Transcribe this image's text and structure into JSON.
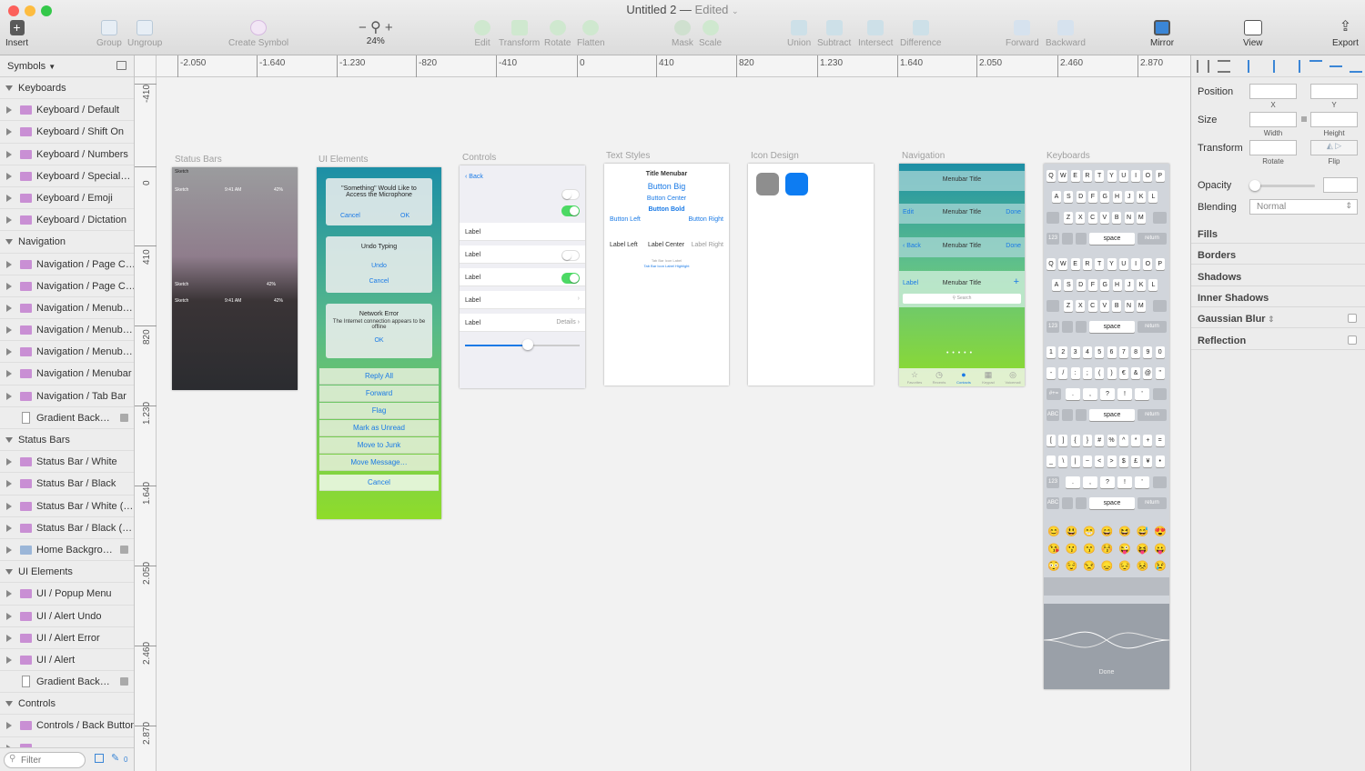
{
  "window": {
    "title": "Untitled 2",
    "status": "Edited"
  },
  "toolbar": {
    "insert": "Insert",
    "group": "Group",
    "ungroup": "Ungroup",
    "create_symbol": "Create Symbol",
    "zoom": "24%",
    "zoom_minus": "−",
    "zoom_plus": "+",
    "edit": "Edit",
    "transform": "Transform",
    "rotate": "Rotate",
    "flatten": "Flatten",
    "mask": "Mask",
    "scale": "Scale",
    "union": "Union",
    "subtract": "Subtract",
    "intersect": "Intersect",
    "difference": "Difference",
    "forward": "Forward",
    "backward": "Backward",
    "mirror": "Mirror",
    "view": "View",
    "export": "Export"
  },
  "ruler_h": [
    "-2.050",
    "-1.640",
    "-1.230",
    "-820",
    "-410",
    "0",
    "410",
    "820",
    "1.230",
    "1.640",
    "2.050",
    "2.460",
    "2.870"
  ],
  "ruler_v": [
    "-410",
    "0",
    "410",
    "820",
    "1.230",
    "1.640",
    "2.050",
    "2.460",
    "2.870"
  ],
  "sidebar": {
    "page_select": "Symbols",
    "rows": [
      {
        "type": "group",
        "label": "Keyboards"
      },
      {
        "type": "item",
        "label": "Keyboard / Default"
      },
      {
        "type": "item",
        "label": "Keyboard / Shift On"
      },
      {
        "type": "item",
        "label": "Keyboard / Numbers"
      },
      {
        "type": "item",
        "label": "Keyboard / Special…"
      },
      {
        "type": "item",
        "label": "Keyboard / Emoji"
      },
      {
        "type": "item",
        "label": "Keyboard / Dictation"
      },
      {
        "type": "group",
        "label": "Navigation"
      },
      {
        "type": "item",
        "label": "Navigation / Page C…"
      },
      {
        "type": "item",
        "label": "Navigation / Page C…"
      },
      {
        "type": "item",
        "label": "Navigation / Menub…"
      },
      {
        "type": "item",
        "label": "Navigation / Menub…"
      },
      {
        "type": "item",
        "label": "Navigation / Menub…"
      },
      {
        "type": "item",
        "label": "Navigation / Menubar"
      },
      {
        "type": "item",
        "label": "Navigation / Tab Bar"
      },
      {
        "type": "doc",
        "label": "Gradient Back…"
      },
      {
        "type": "group",
        "label": "Status Bars"
      },
      {
        "type": "item",
        "label": "Status Bar / White"
      },
      {
        "type": "item",
        "label": "Status Bar / Black"
      },
      {
        "type": "item",
        "label": "Status Bar / White (…"
      },
      {
        "type": "item",
        "label": "Status Bar / Black (…"
      },
      {
        "type": "itemblue",
        "label": "Home Backgro…"
      },
      {
        "type": "group",
        "label": "UI Elements"
      },
      {
        "type": "item",
        "label": "UI / Popup Menu"
      },
      {
        "type": "item",
        "label": "UI / Alert Undo"
      },
      {
        "type": "item",
        "label": "UI / Alert Error"
      },
      {
        "type": "item",
        "label": "UI / Alert"
      },
      {
        "type": "doc",
        "label": "Gradient Back…"
      },
      {
        "type": "group",
        "label": "Controls"
      },
      {
        "type": "item",
        "label": "Controls / Back Button"
      },
      {
        "type": "item",
        "label": ""
      }
    ],
    "filter_placeholder": "Filter",
    "filter_count": "0"
  },
  "artboards": {
    "status_bars": {
      "label": "Status Bars",
      "carrier": "Sketch",
      "time": "9:41 AM",
      "battery": "42%"
    },
    "ui_elements": {
      "label": "UI Elements",
      "alert_title": "\"Something\" Would Like to Access the Microphone",
      "alert_cancel": "Cancel",
      "alert_ok": "OK",
      "undo_title": "Undo Typing",
      "undo_btn": "Undo",
      "undo_cancel": "Cancel",
      "err_title": "Network Error",
      "err_msg": "The Internet connection appears to be offline",
      "err_ok": "OK",
      "actions": [
        "Reply All",
        "Forward",
        "Flag",
        "Mark as Unread",
        "Move to Junk",
        "Move Message…"
      ],
      "cancel": "Cancel"
    },
    "controls": {
      "label": "Controls",
      "back": "Back",
      "row_label": "Label",
      "details": "Details"
    },
    "text_styles": {
      "label": "Text Styles",
      "title_menubar": "Title Menubar",
      "button_big": "Button Big",
      "button_center": "Button Center",
      "button_bold": "Button Bold",
      "button_left": "Button Left",
      "button_right": "Button Right",
      "label_left": "Label Left",
      "label_center": "Label Center",
      "label_right": "Label Right",
      "tab_icon_label": "Tab Bar Icon Label",
      "tab_icon_label_hl": "Tab Bar Icon Label Highlight"
    },
    "icon_design": {
      "label": "Icon Design"
    },
    "navigation": {
      "label": "Navigation",
      "menubar_title": "Menubar Title",
      "edit": "Edit",
      "done": "Done",
      "back": "Back",
      "label_link": "Label",
      "search": "Search",
      "tabs": [
        "Favorites",
        "Recents",
        "Contacts",
        "Keypad",
        "Voicemail"
      ]
    },
    "keyboards": {
      "label": "Keyboards",
      "row1": [
        "Q",
        "W",
        "E",
        "R",
        "T",
        "Y",
        "U",
        "I",
        "O",
        "P"
      ],
      "row2": [
        "A",
        "S",
        "D",
        "F",
        "G",
        "H",
        "J",
        "K",
        "L"
      ],
      "row3": [
        "Z",
        "X",
        "C",
        "V",
        "B",
        "N",
        "M"
      ],
      "num1": [
        "1",
        "2",
        "3",
        "4",
        "5",
        "6",
        "7",
        "8",
        "9",
        "0"
      ],
      "num2": [
        "-",
        "/",
        ":",
        ";",
        "(",
        ")",
        "€",
        "&",
        "@",
        "\""
      ],
      "num3": [
        ".",
        ",",
        "?",
        "!",
        "'"
      ],
      "sym1": [
        "[",
        "]",
        "{",
        "}",
        "#",
        "%",
        "^",
        "*",
        "+",
        "="
      ],
      "sym2": [
        "_",
        "\\",
        "|",
        "~",
        "<",
        ">",
        "$",
        "£",
        "¥",
        "•"
      ],
      "space": "space",
      "ret": "return",
      "k123": "123",
      "abc": "ABC",
      "sym": "#+=",
      "done": "Done",
      "emoji": [
        "😊",
        "😃",
        "😁",
        "😄",
        "😆",
        "😅",
        "😍",
        "😘",
        "😗",
        "😙",
        "😚",
        "😜",
        "😝",
        "😛",
        "😳",
        "😌",
        "😒",
        "😞",
        "😔",
        "😣",
        "😢"
      ]
    }
  },
  "inspector": {
    "position": "Position",
    "x": "X",
    "y": "Y",
    "size": "Size",
    "width": "Width",
    "height": "Height",
    "transform": "Transform",
    "rotate": "Rotate",
    "flip": "Flip",
    "opacity": "Opacity",
    "blending": "Blending",
    "blending_value": "Normal",
    "sections": [
      "Fills",
      "Borders",
      "Shadows",
      "Inner Shadows",
      "Gaussian Blur",
      "Reflection"
    ]
  }
}
